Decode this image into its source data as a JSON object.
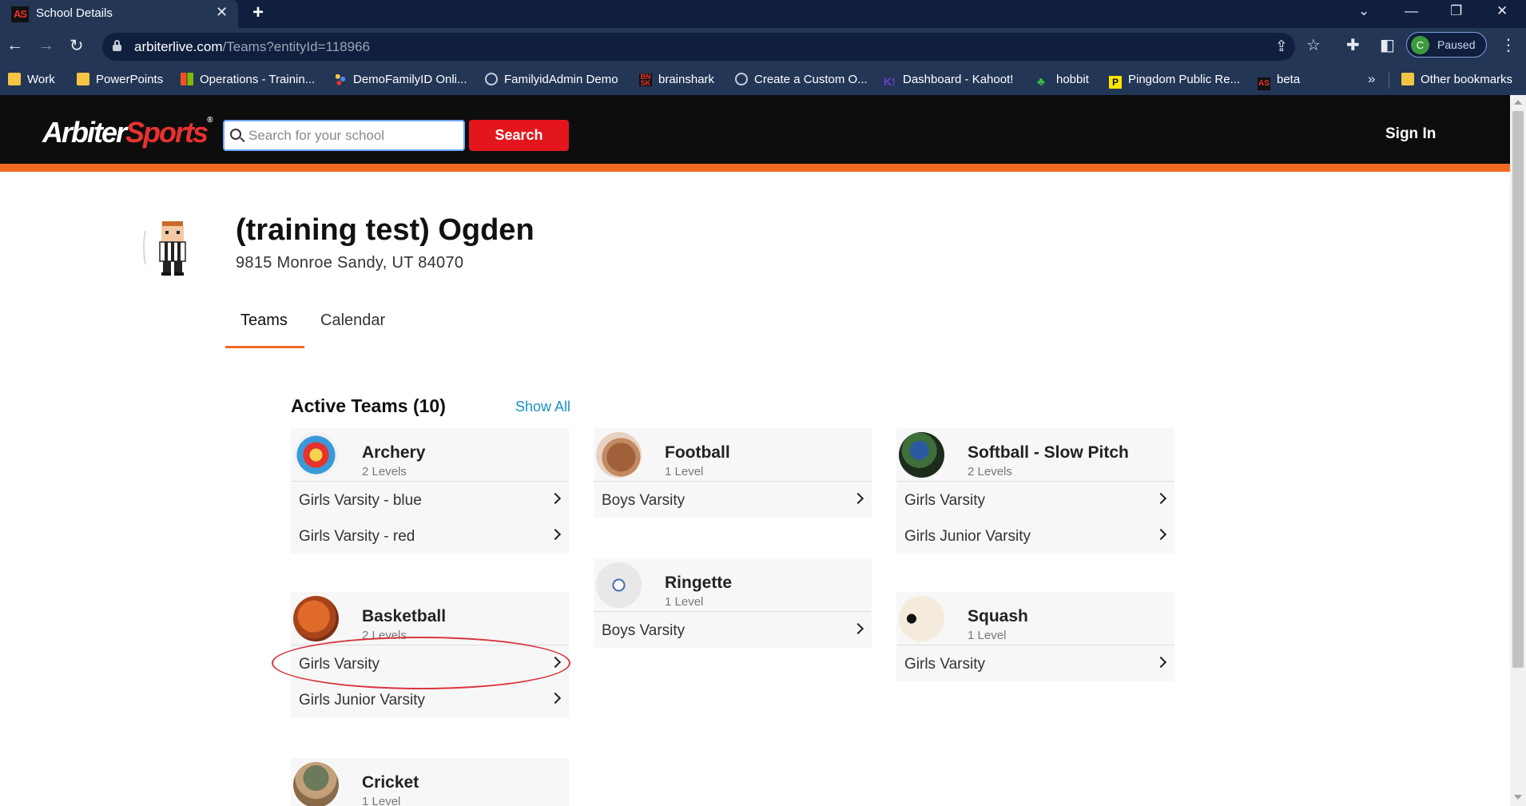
{
  "browser": {
    "tab_title": "School Details",
    "tab_favicon_text": "AS",
    "url_host": "arbiterlive.com",
    "url_path": "/Teams?entityId=118966",
    "profile_initial": "C",
    "profile_label": "Paused"
  },
  "bookmarks": [
    {
      "label": "Work",
      "icon": "folder-icon"
    },
    {
      "label": "PowerPoints",
      "icon": "folder-icon"
    },
    {
      "label": "Operations - Trainin...",
      "icon": "microsoft-icon"
    },
    {
      "label": "DemoFamilyID Onli...",
      "icon": "dots-icon"
    },
    {
      "label": "FamilyidAdmin Demo",
      "icon": "globe-icon"
    },
    {
      "label": "brainshark",
      "icon": "brainshark-icon"
    },
    {
      "label": "Create a Custom O...",
      "icon": "globe-icon"
    },
    {
      "label": "Dashboard - Kahoot!",
      "icon": "kahoot-icon"
    },
    {
      "label": "hobbit",
      "icon": "leaf-icon"
    },
    {
      "label": "Pingdom Public Re...",
      "icon": "pingdom-icon"
    },
    {
      "label": "beta",
      "icon": "arbiter-icon"
    }
  ],
  "other_bookmarks": "Other bookmarks",
  "site": {
    "logo_main": "Arbiter",
    "logo_accent": "Sports",
    "search_placeholder": "Search for your school",
    "search_button": "Search",
    "sign_in": "Sign In"
  },
  "school": {
    "name": "(training test) Ogden",
    "address": "9815 Monroe  Sandy,  UT 84070",
    "tabs": [
      "Teams",
      "Calendar"
    ],
    "active_tab": "Teams"
  },
  "teams": {
    "title": "Active Teams (10)",
    "show_all": "Show All",
    "cards": [
      {
        "sport": "Archery",
        "levels_text": "2 Levels",
        "levels": [
          "Girls Varsity - blue",
          "Girls Varsity - red"
        ]
      },
      {
        "sport": "Basketball",
        "levels_text": "2 Levels",
        "levels": [
          "Girls Varsity",
          "Girls Junior Varsity"
        ]
      },
      {
        "sport": "Cricket",
        "levels_text": "1 Level",
        "levels": []
      },
      {
        "sport": "Football",
        "levels_text": "1 Level",
        "levels": [
          "Boys Varsity"
        ]
      },
      {
        "sport": "Ringette",
        "levels_text": "1 Level",
        "levels": [
          "Boys Varsity"
        ]
      },
      {
        "sport": "Softball - Slow Pitch",
        "levels_text": "2 Levels",
        "levels": [
          "Girls Varsity",
          "Girls Junior Varsity"
        ]
      },
      {
        "sport": "Squash",
        "levels_text": "1 Level",
        "levels": [
          "Girls Varsity"
        ]
      }
    ]
  },
  "colors": {
    "brand_red": "#e4161d",
    "accent_orange": "#ef6b22",
    "link_blue": "#1a91c7",
    "annotation_red": "#d9363e"
  }
}
